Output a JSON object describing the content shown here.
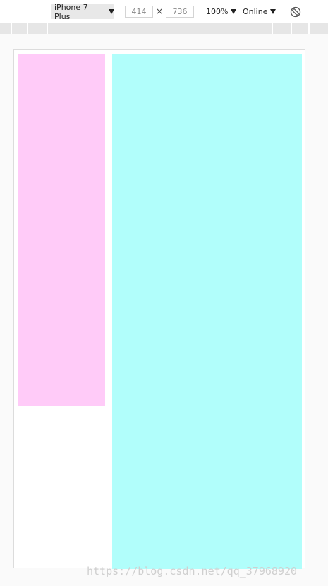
{
  "toolbar": {
    "device": "iPhone 7 Plus",
    "width": "414",
    "height": "736",
    "dimension_separator": "×",
    "zoom": "100%",
    "network": "Online",
    "rotate_icon": "rotate-icon",
    "caret_icon": "caret-down-icon"
  },
  "viewport": {
    "left_box_color": "#ffcbf8",
    "right_box_color": "#b1fefb"
  },
  "watermark": "https://blog.csdn.net/qq_37968920"
}
